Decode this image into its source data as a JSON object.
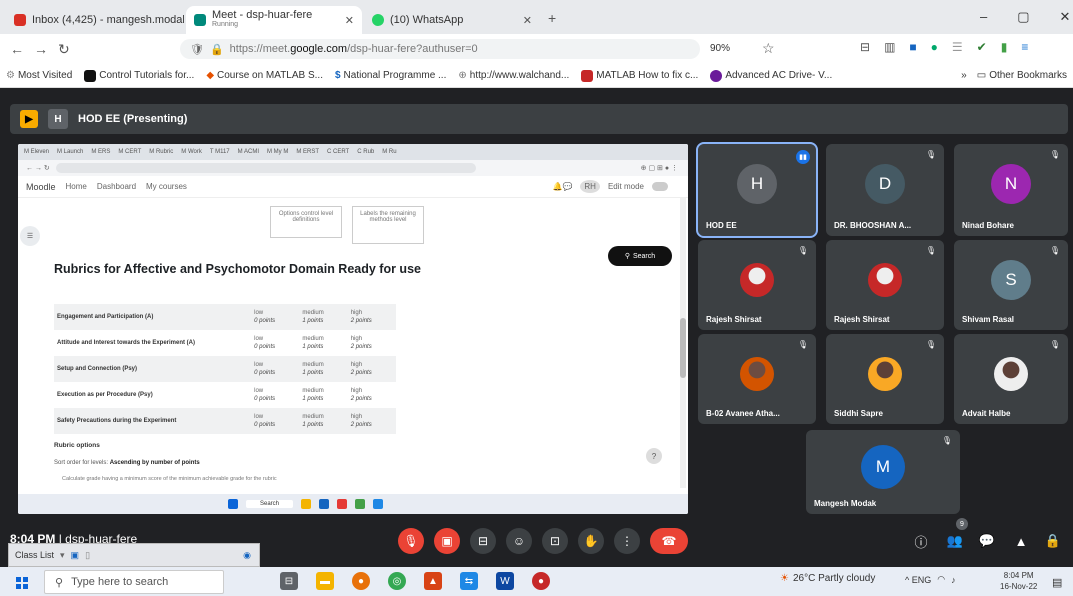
{
  "browser": {
    "tabs": [
      {
        "label": "Inbox (4,425) - mangesh.modak@...",
        "color": "#d93025"
      },
      {
        "label": "Meet - dsp-huar-fere",
        "sub": "Running",
        "color": "#00897b"
      },
      {
        "label": "(10) WhatsApp",
        "color": "#25d366"
      }
    ],
    "new_tab": "+",
    "window_controls": [
      "–",
      "▢",
      "✕"
    ],
    "nav": {
      "back": "←",
      "forward": "→",
      "reload": "↻"
    },
    "url_prefix": "https://meet.",
    "url_domain": "google.com",
    "url_rest": "/dsp-huar-fere?authuser=0",
    "zoom": "90%",
    "bookmarks": [
      "Most Visited",
      "Control Tutorials for...",
      "Course on MATLAB S...",
      "National Programme ...",
      "http://www.walchand...",
      "MATLAB How to fix c...",
      "Advanced AC Drive- V..."
    ],
    "other_bookmarks": "Other Bookmarks",
    "bookmark_more": "»"
  },
  "meet": {
    "presenting_label": "HOD EE (Presenting)",
    "presenting_icon_letter": "H",
    "time": "8:04 PM",
    "meeting_code": "dsp-huar-fere",
    "separator": "|",
    "participants": [
      {
        "name": "HOD EE",
        "initial": "H",
        "color": "#5f6368",
        "speaking": true
      },
      {
        "name": "DR. BHOOSHAN A...",
        "initial": "D",
        "color": "#455a64"
      },
      {
        "name": "Ninad Bohare",
        "initial": "N",
        "color": "#9c27b0"
      },
      {
        "name": "Rajesh Shirsat",
        "photo": true
      },
      {
        "name": "Rajesh Shirsat",
        "photo": true
      },
      {
        "name": "Shivam Rasal",
        "initial": "S",
        "color": "#607d8b"
      },
      {
        "name": "B-02 Avanee Atha...",
        "photo": true
      },
      {
        "name": "Siddhi Sapre",
        "photo": true
      },
      {
        "name": "Advait Halbe",
        "photo": true
      },
      {
        "name": "Mangesh Modak",
        "initial": "M",
        "color": "#1565c0"
      }
    ],
    "participants_badge": "9"
  },
  "shared_screen": {
    "app": "Moodle",
    "nav_links": [
      "Home",
      "Dashboard",
      "My courses"
    ],
    "edit_mode": "Edit mode",
    "tabs": [
      "M Eleven",
      "M Launch",
      "M ERS",
      "M CERT",
      "M Rubric",
      "M Work",
      "T M117",
      "M ACMI",
      "M My M",
      "M ERST",
      "C CERT",
      "C Rub",
      "M Ru"
    ],
    "card1": "Options control level definitions",
    "card2": "Labels the remaining methods level",
    "heading": "Rubrics for Affective and Psychomotor Domain Ready for use",
    "search_label": "Search",
    "rubric_rows": [
      {
        "criterion": "Engagement and Participation (A)",
        "levels": [
          [
            "low",
            "0 points"
          ],
          [
            "medium",
            "1 points"
          ],
          [
            "high",
            "2 points"
          ]
        ]
      },
      {
        "criterion": "Attitude and Interest towards the Experiment (A)",
        "levels": [
          [
            "low",
            "0 points"
          ],
          [
            "medium",
            "1 points"
          ],
          [
            "high",
            "2 points"
          ]
        ]
      },
      {
        "criterion": "Setup and Connection (Psy)",
        "levels": [
          [
            "low",
            "0 points"
          ],
          [
            "medium",
            "1 points"
          ],
          [
            "high",
            "2 points"
          ]
        ]
      },
      {
        "criterion": "Execution as per Procedure (Psy)",
        "levels": [
          [
            "low",
            "0 points"
          ],
          [
            "medium",
            "1 points"
          ],
          [
            "high",
            "2 points"
          ]
        ]
      },
      {
        "criterion": "Safety Precautions during the Experiment",
        "levels": [
          [
            "low",
            "0 points"
          ],
          [
            "medium",
            "1 points"
          ],
          [
            "high",
            "2 points"
          ]
        ]
      }
    ],
    "options_title": "Rubric options",
    "sort_prefix": "Sort order for levels:",
    "sort_value": "Ascending by number of points",
    "more_text": "Calculate grade having a minimum score of the minimum achievable grade for the rubric",
    "help": "?",
    "taskbar_search": "Search"
  },
  "classlist": {
    "label": "Class List"
  },
  "windows": {
    "search_placeholder": "Type here to search",
    "weather": "26°C  Partly cloudy",
    "tray": "^  ENG",
    "time": "8:04 PM",
    "date": "16-Nov-22"
  }
}
